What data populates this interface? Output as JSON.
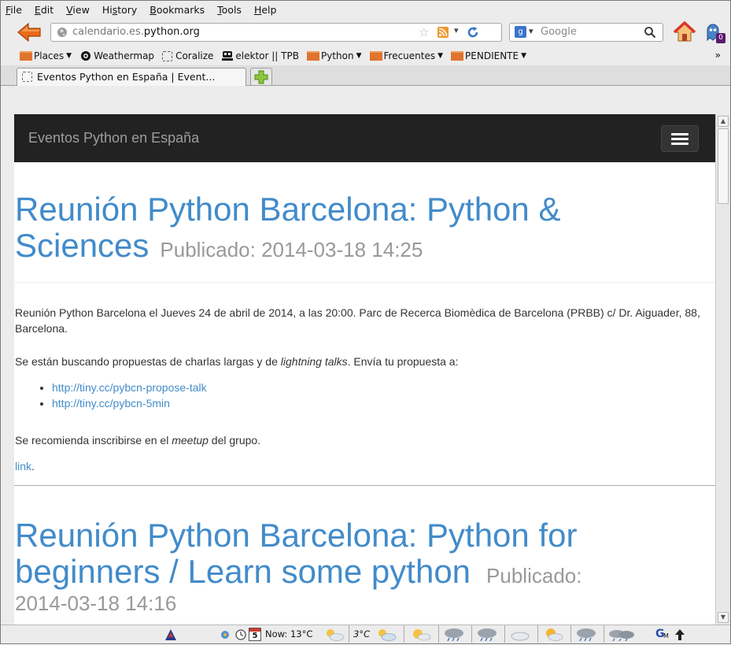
{
  "menu": [
    {
      "key": "F",
      "rest": "ile"
    },
    {
      "key": "E",
      "rest": "dit"
    },
    {
      "key": "V",
      "rest": "iew"
    },
    {
      "pre": "Hi",
      "key": "s",
      "rest": "tory"
    },
    {
      "key": "B",
      "rest": "ookmarks"
    },
    {
      "key": "T",
      "rest": "ools"
    },
    {
      "key": "H",
      "rest": "elp"
    }
  ],
  "navbar": {
    "url_domain": "calendario.es.",
    "url_host": "python.org",
    "search_placeholder": "Google",
    "addon_badge": "0"
  },
  "bookmarks": [
    {
      "label": "Places",
      "icon": "folder-icon",
      "dropdown": true
    },
    {
      "label": "Weathermap",
      "icon": "weathermap-icon",
      "dropdown": false
    },
    {
      "label": "Coralize",
      "icon": "blank-page-icon",
      "dropdown": false
    },
    {
      "label": "elektor || TPB",
      "icon": "pirate-icon",
      "dropdown": false
    },
    {
      "label": "Python",
      "icon": "folder-icon",
      "dropdown": true
    },
    {
      "label": "Frecuentes",
      "icon": "folder-icon",
      "dropdown": true
    },
    {
      "label": "PENDIENTE",
      "icon": "folder-icon",
      "dropdown": true
    }
  ],
  "bookmarks_more": "»",
  "tab": {
    "label": "Eventos Python en España | Event..."
  },
  "site": {
    "brand": "Eventos Python en España",
    "post1": {
      "title": "Reunión Python Barcelona: Python & Sciences",
      "published": "Publicado: 2014-03-18 14:25",
      "para1": "Reunión Python Barcelona el Jueves 24 de abril de 2014, a las 20:00. Parc de Recerca Biomèdica de Barcelona (PRBB) c/ Dr. Aiguader, 88, Barcelona.",
      "para2_a": "Se están buscando propuestas de charlas largas y de ",
      "para2_em": "lightning talks",
      "para2_b": ". Envía tu propuesta a:",
      "links": [
        "http://tiny.cc/pybcn-propose-talk",
        "http://tiny.cc/pybcn-5min"
      ],
      "para3_a": "Se recomienda inscribirse en el ",
      "para3_em": "meetup",
      "para3_b": " del grupo.",
      "link_label": "link",
      "link_after": "."
    },
    "post2": {
      "title": "Reunión Python Barcelona: Python for beginners / Learn some python",
      "published_label": "Publicado:",
      "published_date": "2014-03-18 14:16"
    }
  },
  "statusbar": {
    "calendar_day": "5",
    "now_label": "Now: 13°C",
    "temp2": "3°C"
  },
  "colors": {
    "link": "#428bca",
    "navbar_bg": "#222222",
    "brand_text": "#9d9d9d",
    "muted": "#999999"
  }
}
